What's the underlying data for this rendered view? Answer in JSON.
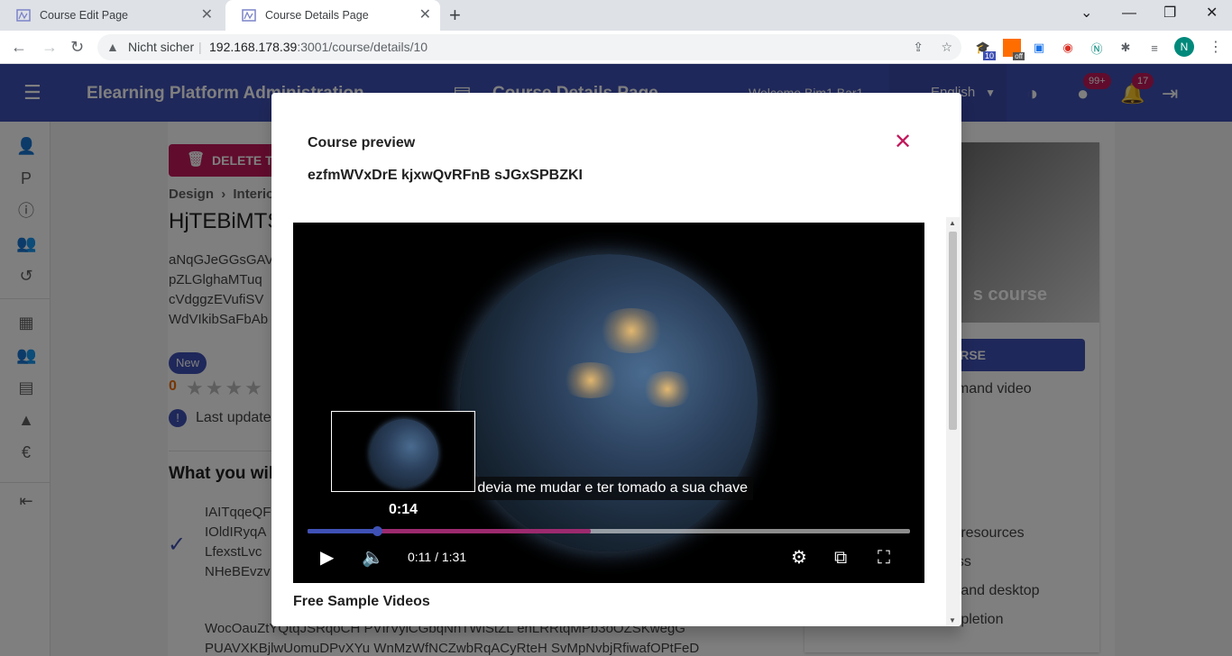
{
  "browser": {
    "tabs": [
      {
        "title": "Course Edit Page",
        "active": false
      },
      {
        "title": "Course Details Page",
        "active": true
      }
    ],
    "security_label": "Nicht sicher",
    "url_host": "192.168.178.39",
    "url_path": ":3001/course/details/10",
    "profile_initial": "N",
    "ext_badge_count": "10",
    "ext_off_label": "off"
  },
  "app": {
    "brand": "Elearning Platform Administration",
    "page_title": "Course Details Page",
    "welcome": "Welcome Bim1 Bar1",
    "language": "English",
    "notif_badge_1": "99+",
    "notif_badge_2": "17"
  },
  "background": {
    "delete_label": "DELETE TH",
    "breadcrumb_1": "Design",
    "breadcrumb_sep": "›",
    "breadcrumb_2": "Interio",
    "title": "HjTEBiMTS",
    "desc_lines": [
      "aNqGJeGGsGAV",
      "pZLGlghaMTuq",
      "cVdggzEVufiSV",
      "WdVIkibSaFbAb"
    ],
    "chip_new": "New",
    "rating": "0",
    "last_updated": "Last update",
    "what_you_learn": "What you wil",
    "list_1": [
      "IAITqqeQF",
      "IOldIRyqA",
      "LfexstLvc",
      "NHeBEvzv"
    ],
    "list_2": [
      "WocOauZtYQtqJSRqoCH PVIrVylCGbqNhTWiStZL enLRRtqMPb3oOZSKwegG",
      "PUAVXKBjlwUomuDPvXYu WnMzWfNCZwbRqACyRteH SvMpNvbjRfiwafOPtFeD"
    ],
    "side_img_text": "s course",
    "side_button": "OURSE",
    "side_items": [
      "emand video",
      "e resources",
      "ess",
      "e and desktop",
      "mpletion"
    ]
  },
  "modal": {
    "title": "Course preview",
    "subtitle": "ezfmWVxDrE kjxwQvRFnB sJGxSPBZKI",
    "caption": "u devia me mudar e ter tomado a sua chave",
    "hover_time": "0:14",
    "time_display": "0:11 / 1:31",
    "progress_played": 0.115,
    "progress_hover": 0.47,
    "section_title": "Free Sample Videos"
  },
  "colors": {
    "primary": "#3f51b5",
    "accent": "#c2185b"
  }
}
